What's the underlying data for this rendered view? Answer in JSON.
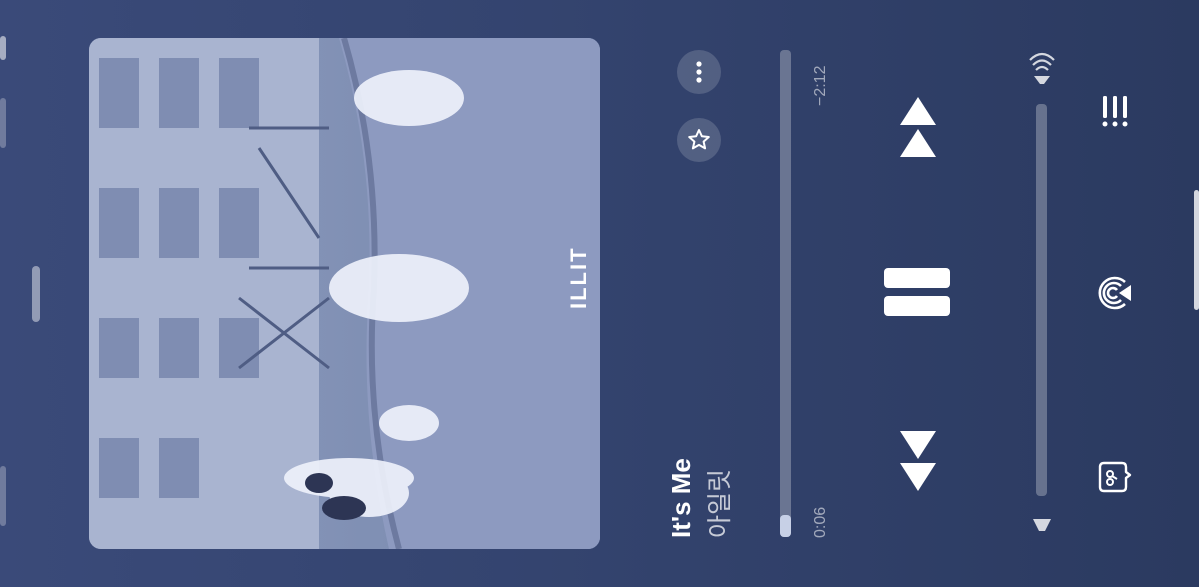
{
  "now_playing": {
    "title": "It's Me",
    "artist": "아일릿",
    "artwork_logo": "ILLIT"
  },
  "progress": {
    "elapsed": "0:06",
    "remaining": "−2:12",
    "fraction": 0.045
  },
  "volume": {
    "fraction": 0.0
  },
  "icons": {
    "more": "more-icon",
    "favorite": "star-icon",
    "previous": "previous-track-icon",
    "pause": "pause-icon",
    "next": "next-track-icon",
    "volume_low": "volume-low-icon",
    "volume_high": "volume-high-icon",
    "lyrics": "lyrics-icon",
    "airplay": "airplay-icon",
    "queue": "queue-icon"
  },
  "colors": {
    "background": "#34446f",
    "track": "#6a7aa3",
    "fill": "#c7d0e6"
  }
}
